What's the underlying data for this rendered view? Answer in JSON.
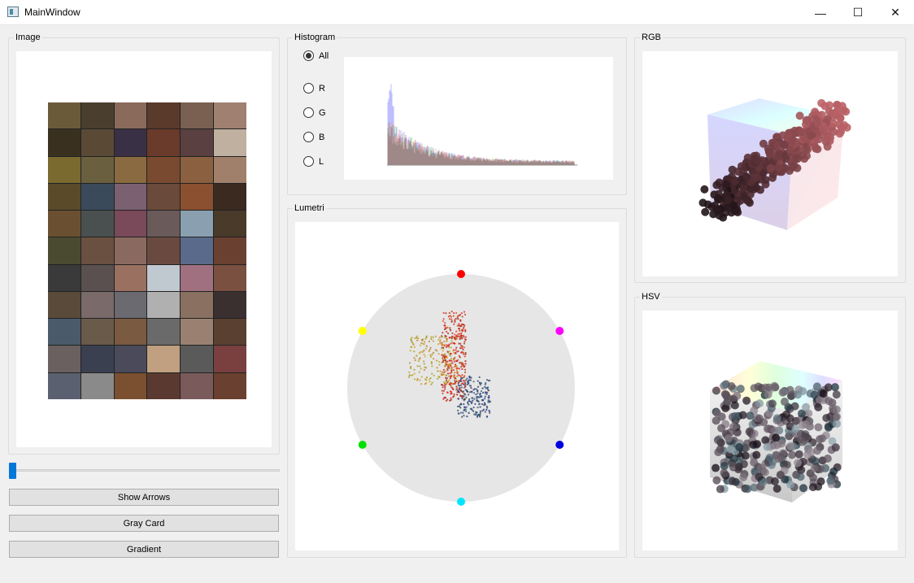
{
  "window": {
    "title": "MainWindow",
    "minimize_glyph": "—",
    "maximize_glyph": "☐",
    "close_glyph": "✕"
  },
  "image_panel": {
    "label": "Image",
    "mosaic_colors": [
      "#6b5a3a",
      "#4a3f2f",
      "#8a6a5a",
      "#5a3a2a",
      "#7a6050",
      "#a08070",
      "#3a3020",
      "#5a4a35",
      "#3a3045",
      "#6a3a2a",
      "#5a4040",
      "#c0b0a0",
      "#7a6a30",
      "#6a6040",
      "#8a6a40",
      "#7a4a30",
      "#8a6040",
      "#a0806a",
      "#5a4a2a",
      "#3a4a5a",
      "#7a6070",
      "#6a4a3a",
      "#8a5030",
      "#3a2a20",
      "#6a5030",
      "#4a5050",
      "#7a4a5a",
      "#6a5a5a",
      "#8aa0b0",
      "#4a3a2a",
      "#4a4a30",
      "#6a5040",
      "#8a6a60",
      "#6a4a40",
      "#5a6a8a",
      "#6a4030",
      "#3a3a3a",
      "#5a5050",
      "#9a7060",
      "#c0c8d0",
      "#a07080",
      "#7a5040",
      "#5a4a3a",
      "#7a6a6a",
      "#6a6a70",
      "#b0b0b0",
      "#8a7060",
      "#3a3030",
      "#4a5a6a",
      "#6a5a4a",
      "#7a5a40",
      "#6a6a6a",
      "#9a8070",
      "#5a4030",
      "#6a6060",
      "#3a4050",
      "#4a4a5a",
      "#c0a080",
      "#5a5a5a",
      "#7a4040",
      "#5a6070",
      "#8a8a8a",
      "#7a5030",
      "#5a3a30",
      "#7a5a5a",
      "#6a4030",
      "#5a4a20",
      "#3a3a20",
      "#7a6040",
      "#a07040",
      "#6a4a30",
      "#8a7050"
    ]
  },
  "slider": {
    "value": 0
  },
  "buttons": {
    "show_arrows": "Show Arrows",
    "gray_card": "Gray Card",
    "gradient": "Gradient"
  },
  "histogram_panel": {
    "label": "Histogram",
    "options": [
      {
        "label": "All",
        "checked": true
      },
      {
        "label": "R",
        "checked": false
      },
      {
        "label": "G",
        "checked": false
      },
      {
        "label": "B",
        "checked": false
      },
      {
        "label": "L",
        "checked": false
      }
    ]
  },
  "lumetri_panel": {
    "label": "Lumetri",
    "hue_markers": [
      {
        "name": "red",
        "color": "#ff0000"
      },
      {
        "name": "magenta",
        "color": "#ff00ff"
      },
      {
        "name": "blue",
        "color": "#0000e0"
      },
      {
        "name": "cyan",
        "color": "#00e5ff"
      },
      {
        "name": "green",
        "color": "#00e000"
      },
      {
        "name": "yellow",
        "color": "#ffff00"
      }
    ]
  },
  "rgb_panel": {
    "label": "RGB"
  },
  "hsv_panel": {
    "label": "HSV"
  }
}
